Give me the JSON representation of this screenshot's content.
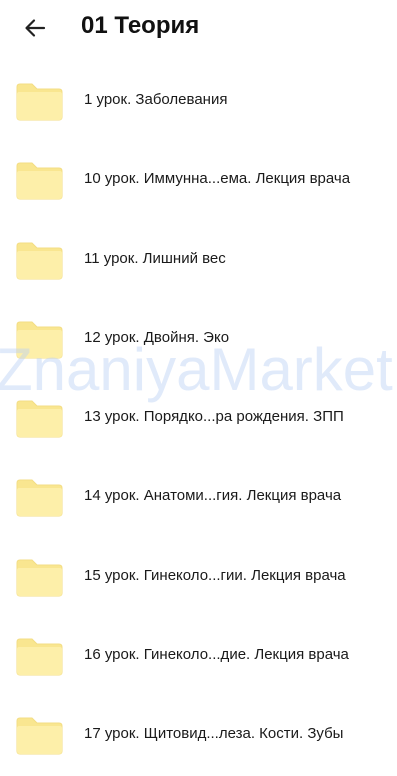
{
  "header": {
    "back_icon": "arrow-left-icon",
    "title": "01 Теория"
  },
  "folder_icon": "folder-icon",
  "colors": {
    "folder_fill": "#fdefa9",
    "folder_tab": "#f9e690",
    "folder_stroke": "#f3dd84",
    "watermark": "#bcd1f4"
  },
  "items": [
    {
      "label": "1 урок. Заболевания"
    },
    {
      "label": "10 урок. Иммунна...ема. Лекция врача"
    },
    {
      "label": "11 урок. Лишний вес"
    },
    {
      "label": "12 урок. Двойня. Эко"
    },
    {
      "label": "13 урок. Порядко...ра рождения. ЗПП"
    },
    {
      "label": "14 урок. Анатоми...гия. Лекция врача"
    },
    {
      "label": "15 урок. Гинеколо...гии. Лекция врача"
    },
    {
      "label": "16 урок. Гинеколо...дие. Лекция врача"
    },
    {
      "label": "17 урок. Щитовид...леза. Кости. Зубы"
    }
  ],
  "watermark": "ZnaniyaMarket"
}
